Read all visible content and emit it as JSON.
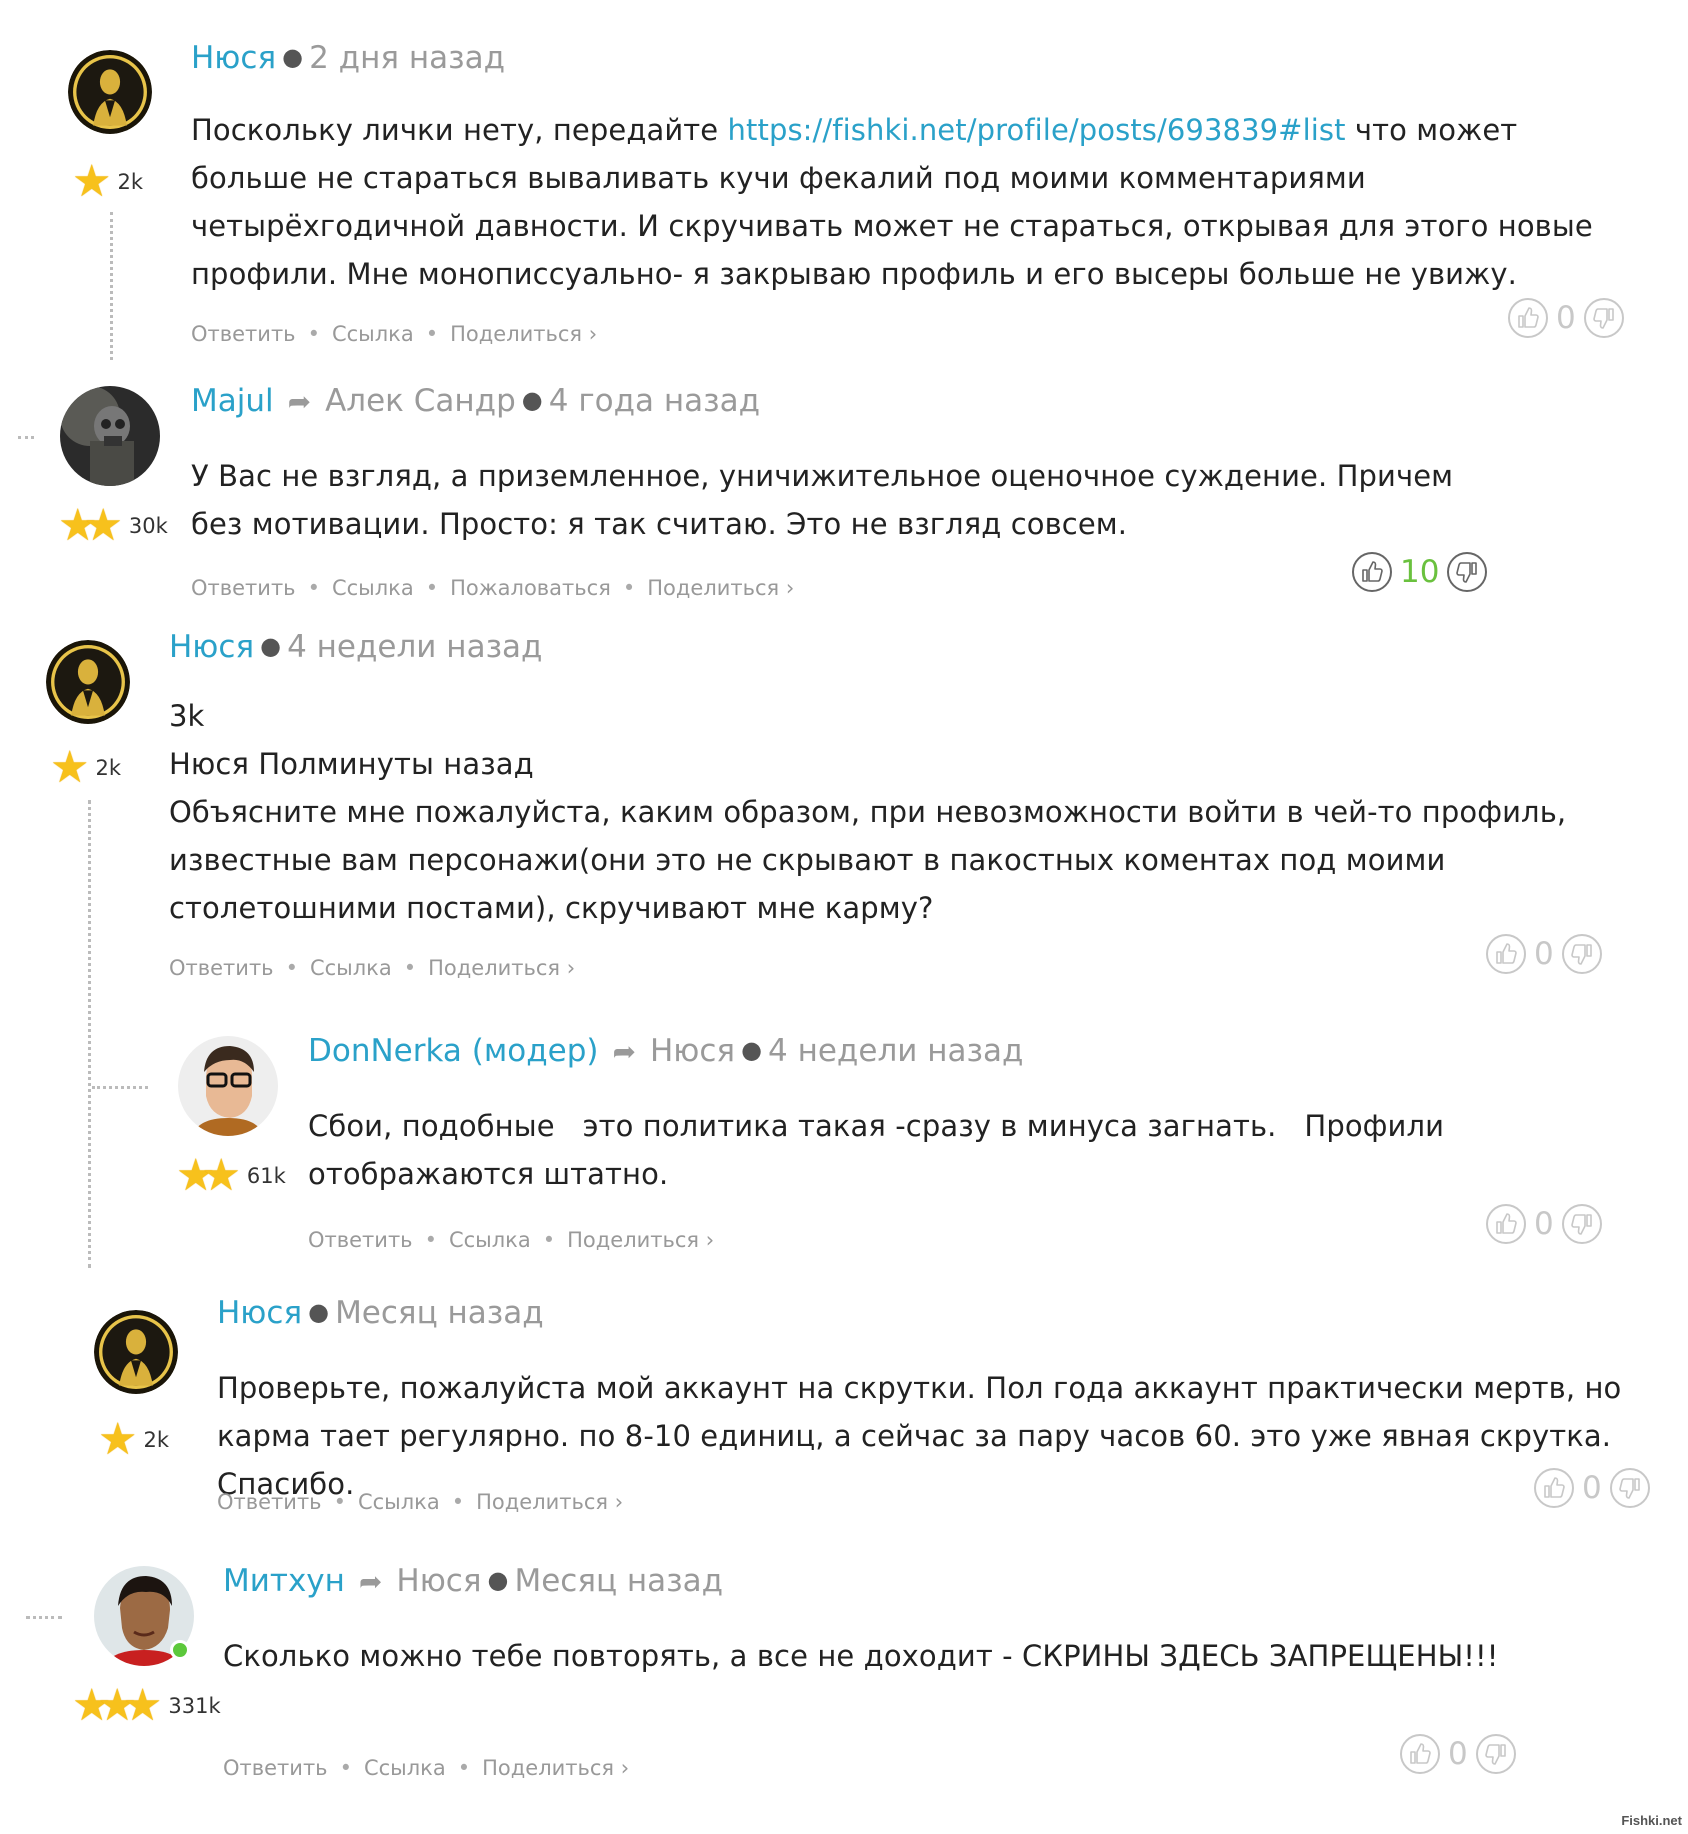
{
  "comments": [
    {
      "author": "Нюся",
      "time": "2 дня назад",
      "karma": "2k",
      "stars": 1,
      "body_pre": "Поскольку лички нету, передайте ",
      "link": "https://fishki.net/profile/posts/693839#list",
      "body_post": " что может больше не стараться вываливать кучи фекалий под моими комментариями четырёхгодичной давности. И скручивать может не стараться, открывая для этого новые профили. Мне монописсуально- я закрываю профиль и его высеры больше не увижу.",
      "actions": [
        "Ответить",
        "Ссылка",
        "Поделиться ›"
      ],
      "votes": "0"
    },
    {
      "author": "Majul",
      "reply_to": "Алек Сандр",
      "time": "4 года назад",
      "karma": "30k",
      "stars": 2,
      "body": "У Вас не взгляд, а приземленное, уничижительное оценочное суждение. Причем без мотивации. Просто: я так считаю. Это не взгляд совсем.",
      "actions": [
        "Ответить",
        "Ссылка",
        "Пожаловаться",
        "Поделиться ›"
      ],
      "votes": "10"
    },
    {
      "author": "Нюся",
      "time": "4 недели назад",
      "karma": "2k",
      "stars": 1,
      "body_lines": [
        "3k",
        "Нюся Полминуты назад",
        "Объясните мне пожалуйста, каким образом, при невозможности войти в чей-то профиль, известные вам персонажи(они это не скрывают в пакостных коментах под моими столетошними постами), скручивают мне карму?"
      ],
      "actions": [
        "Ответить",
        "Ссылка",
        "Поделиться ›"
      ],
      "votes": "0"
    },
    {
      "author": "DonNerka (модер)",
      "reply_to": "Нюся",
      "time": "4 недели назад",
      "karma": "61k",
      "stars": 2,
      "body": "Сбои, подобные   это политика такая -сразу в минуса загнать.   Профили отображаются штатно.",
      "actions": [
        "Ответить",
        "Ссылка",
        "Поделиться ›"
      ],
      "votes": "0"
    },
    {
      "author": "Нюся",
      "time": "Месяц назад",
      "karma": "2k",
      "stars": 1,
      "body": "Проверьте, пожалуйста мой аккаунт на скрутки. Пол года аккаунт практически мертв, но карма тает регулярно. по 8-10 единиц, а сейчас за пару часов 60. это уже явная скрутка. Спасибо.",
      "actions": [
        "Ответить",
        "Ссылка",
        "Поделиться ›"
      ],
      "votes": "0"
    },
    {
      "author": "Митхун",
      "reply_to": "Нюся",
      "time": "Месяц назад",
      "karma": "331k",
      "stars": 3,
      "body": "Сколько можно тебе повторять, а все не доходит - СКРИНЫ ЗДЕСЬ ЗАПРЕЩЕНЫ!!!",
      "actions": [
        "Ответить",
        "Ссылка",
        "Поделиться ›"
      ],
      "votes": "0"
    }
  ],
  "icons": {
    "star": "star-icon",
    "reply": "reply-arrow-icon",
    "like": "thumbs-up-icon",
    "dislike": "thumbs-down-icon"
  },
  "colors": {
    "author": "#2aa1c9",
    "link": "#2aa1c9",
    "positive_votes": "#6ac13e",
    "star": "#f7c11c"
  },
  "watermark": "Fishki.net"
}
